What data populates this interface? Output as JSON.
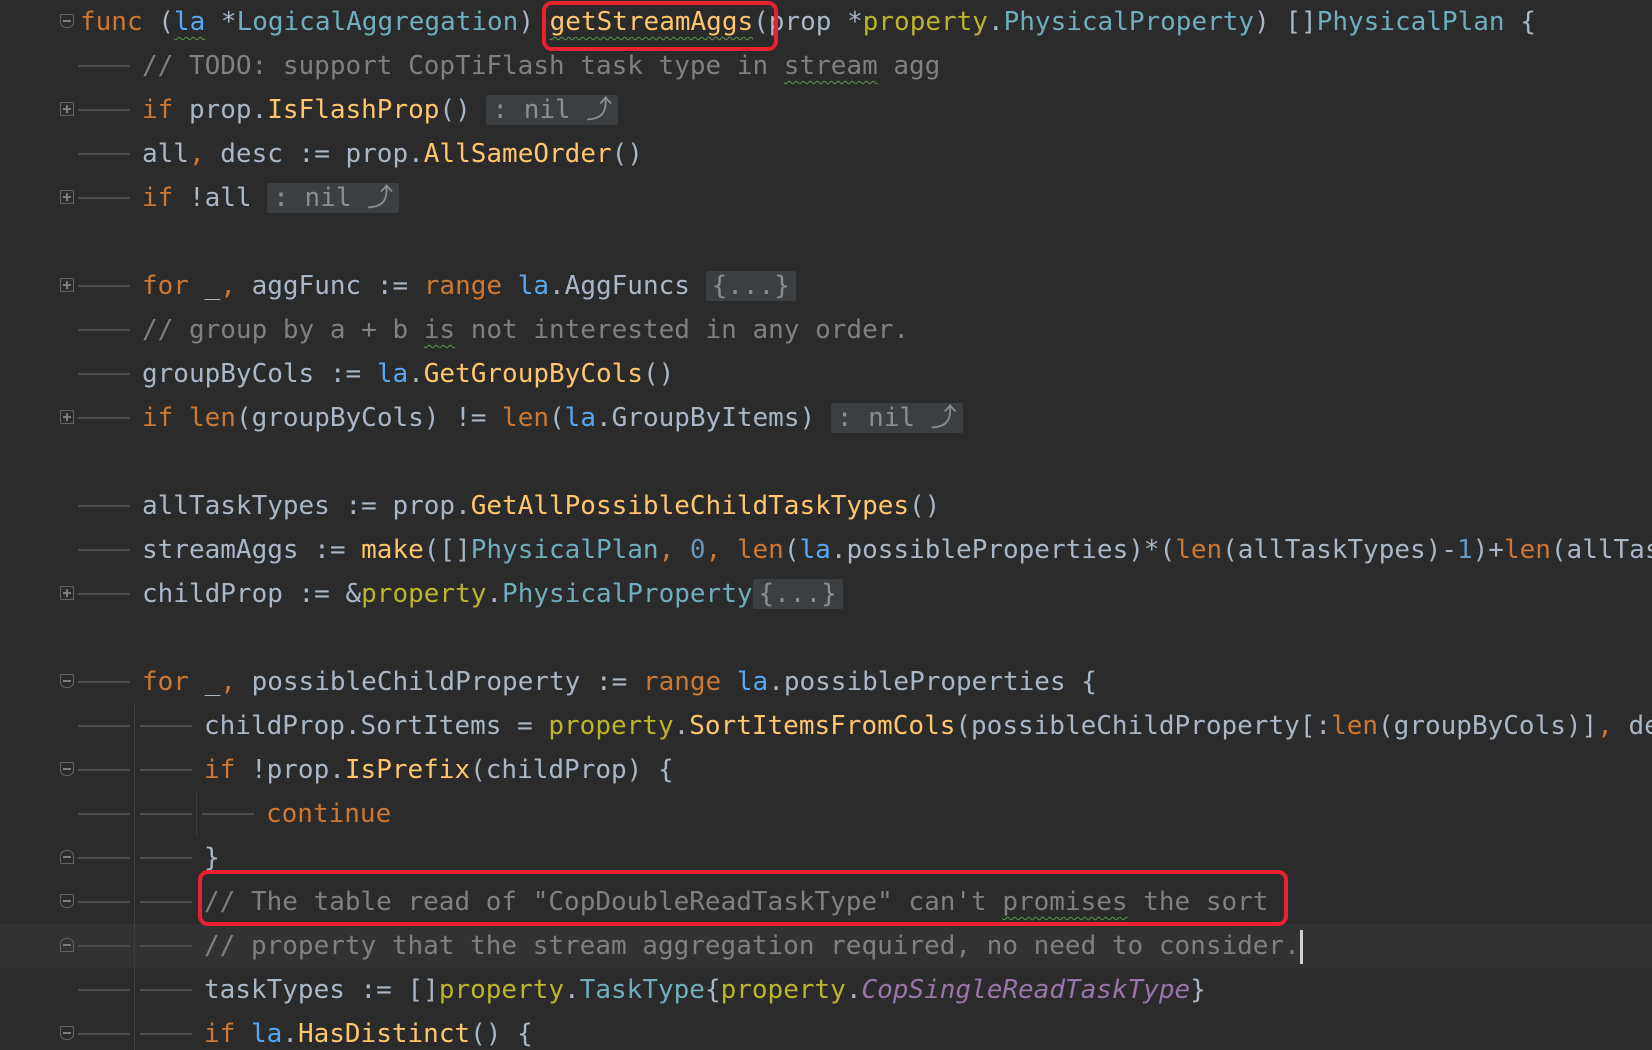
{
  "editor": {
    "language": "go",
    "annotations": [
      "function-name-box",
      "comment-box"
    ],
    "lines": [
      {
        "fold": "top",
        "tokens": [
          {
            "t": "func",
            "c": "kw"
          },
          {
            "t": " (",
            "c": "plain"
          },
          {
            "t": "la",
            "c": "rcv squiggle"
          },
          {
            "t": " *",
            "c": "plain"
          },
          {
            "t": "LogicalAggregation",
            "c": "ty"
          },
          {
            "t": ") ",
            "c": "plain"
          },
          {
            "t": "getStreamAggs",
            "c": "fn squiggle"
          },
          {
            "t": "(",
            "c": "plain"
          },
          {
            "t": "prop",
            "c": "plain"
          },
          {
            "t": " *",
            "c": "plain"
          },
          {
            "t": "property",
            "c": "pkg"
          },
          {
            "t": ".",
            "c": "plain"
          },
          {
            "t": "PhysicalProperty",
            "c": "ty"
          },
          {
            "t": ") []",
            "c": "plain"
          },
          {
            "t": "PhysicalPlan",
            "c": "ty"
          },
          {
            "t": " {",
            "c": "plain"
          }
        ]
      },
      {
        "indent": 1,
        "tokens": [
          {
            "t": "// TODO: support CopTiFlash task type in ",
            "c": "cm"
          },
          {
            "t": "stream",
            "c": "cm squiggle"
          },
          {
            "t": " agg",
            "c": "cm"
          }
        ]
      },
      {
        "indent": 1,
        "fold": "plus",
        "tokens": [
          {
            "t": "if",
            "c": "kw"
          },
          {
            "t": " prop.",
            "c": "plain"
          },
          {
            "t": "IsFlashProp",
            "c": "fn"
          },
          {
            "t": "() ",
            "c": "plain"
          },
          {
            "t": ": nil ⤴",
            "c": "fold-badge"
          }
        ]
      },
      {
        "indent": 1,
        "tokens": [
          {
            "t": "all",
            "c": "plain"
          },
          {
            "t": ",",
            "c": "kw"
          },
          {
            "t": " desc := prop.",
            "c": "plain"
          },
          {
            "t": "AllSameOrder",
            "c": "fn"
          },
          {
            "t": "()",
            "c": "plain"
          }
        ]
      },
      {
        "indent": 1,
        "fold": "plus",
        "tokens": [
          {
            "t": "if",
            "c": "kw"
          },
          {
            "t": " !all ",
            "c": "plain"
          },
          {
            "t": ": nil ⤴",
            "c": "fold-badge"
          }
        ]
      },
      {
        "blank": true,
        "tokens": []
      },
      {
        "indent": 1,
        "fold": "plus",
        "tokens": [
          {
            "t": "for",
            "c": "kw"
          },
          {
            "t": " _",
            "c": "plain"
          },
          {
            "t": ",",
            "c": "kw"
          },
          {
            "t": " aggFunc := ",
            "c": "plain"
          },
          {
            "t": "range",
            "c": "kw"
          },
          {
            "t": " ",
            "c": "plain"
          },
          {
            "t": "la",
            "c": "rcv"
          },
          {
            "t": ".AggFuncs ",
            "c": "plain"
          },
          {
            "t": "{...}",
            "c": "fold-badge"
          }
        ]
      },
      {
        "indent": 1,
        "tokens": [
          {
            "t": "// group by a + b ",
            "c": "cm"
          },
          {
            "t": "is",
            "c": "cm squiggle"
          },
          {
            "t": " not interested in any order.",
            "c": "cm"
          }
        ]
      },
      {
        "indent": 1,
        "tokens": [
          {
            "t": "groupByCols := ",
            "c": "plain"
          },
          {
            "t": "la",
            "c": "rcv"
          },
          {
            "t": ".",
            "c": "plain"
          },
          {
            "t": "GetGroupByCols",
            "c": "fn"
          },
          {
            "t": "()",
            "c": "plain"
          }
        ]
      },
      {
        "indent": 1,
        "fold": "plus",
        "tokens": [
          {
            "t": "if",
            "c": "kw"
          },
          {
            "t": " ",
            "c": "plain"
          },
          {
            "t": "len",
            "c": "kw"
          },
          {
            "t": "(groupByCols) != ",
            "c": "plain"
          },
          {
            "t": "len",
            "c": "kw"
          },
          {
            "t": "(",
            "c": "plain"
          },
          {
            "t": "la",
            "c": "rcv"
          },
          {
            "t": ".GroupByItems) ",
            "c": "plain"
          },
          {
            "t": ": nil ⤴",
            "c": "fold-badge"
          }
        ]
      },
      {
        "blank": true,
        "tokens": []
      },
      {
        "indent": 1,
        "tokens": [
          {
            "t": "allTaskTypes := prop.",
            "c": "plain"
          },
          {
            "t": "GetAllPossibleChildTaskTypes",
            "c": "fn"
          },
          {
            "t": "()",
            "c": "plain"
          }
        ]
      },
      {
        "indent": 1,
        "tokens": [
          {
            "t": "streamAggs := ",
            "c": "plain"
          },
          {
            "t": "make",
            "c": "fn"
          },
          {
            "t": "([]",
            "c": "plain"
          },
          {
            "t": "PhysicalPlan",
            "c": "ty"
          },
          {
            "t": ", ",
            "c": "kw"
          },
          {
            "t": "0",
            "c": "num"
          },
          {
            "t": ", ",
            "c": "kw"
          },
          {
            "t": "len",
            "c": "kw"
          },
          {
            "t": "(",
            "c": "plain"
          },
          {
            "t": "la",
            "c": "rcv"
          },
          {
            "t": ".possibleProperties)*(",
            "c": "plain"
          },
          {
            "t": "len",
            "c": "kw"
          },
          {
            "t": "(allTaskTypes)-",
            "c": "plain"
          },
          {
            "t": "1",
            "c": "num"
          },
          {
            "t": ")+",
            "c": "plain"
          },
          {
            "t": "len",
            "c": "kw"
          },
          {
            "t": "(allTas",
            "c": "plain"
          }
        ]
      },
      {
        "indent": 1,
        "fold": "plus",
        "tokens": [
          {
            "t": "childProp := &",
            "c": "plain"
          },
          {
            "t": "property",
            "c": "pkg"
          },
          {
            "t": ".",
            "c": "plain"
          },
          {
            "t": "PhysicalProperty",
            "c": "ty"
          },
          {
            "t": "{...}",
            "c": "fold-badge"
          }
        ]
      },
      {
        "blank": true,
        "tokens": []
      },
      {
        "indent": 1,
        "fold": "top",
        "tokens": [
          {
            "t": "for",
            "c": "kw"
          },
          {
            "t": " _",
            "c": "plain"
          },
          {
            "t": ",",
            "c": "kw"
          },
          {
            "t": " possibleChildProperty := ",
            "c": "plain"
          },
          {
            "t": "range",
            "c": "kw"
          },
          {
            "t": " ",
            "c": "plain"
          },
          {
            "t": "la",
            "c": "rcv"
          },
          {
            "t": ".possibleProperties {",
            "c": "plain"
          }
        ]
      },
      {
        "indent": 2,
        "tokens": [
          {
            "t": "childProp.SortItems = ",
            "c": "plain"
          },
          {
            "t": "property",
            "c": "pkg"
          },
          {
            "t": ".",
            "c": "plain"
          },
          {
            "t": "SortItemsFromCols",
            "c": "fn"
          },
          {
            "t": "(possibleChildProperty[:",
            "c": "plain"
          },
          {
            "t": "len",
            "c": "kw"
          },
          {
            "t": "(groupByCols)]",
            "c": "plain"
          },
          {
            "t": ", ",
            "c": "kw"
          },
          {
            "t": "de",
            "c": "plain"
          }
        ]
      },
      {
        "indent": 2,
        "fold": "top",
        "tokens": [
          {
            "t": "if",
            "c": "kw"
          },
          {
            "t": " !prop.",
            "c": "plain"
          },
          {
            "t": "IsPrefix",
            "c": "fn"
          },
          {
            "t": "(childProp) {",
            "c": "plain"
          }
        ]
      },
      {
        "indent": 3,
        "tokens": [
          {
            "t": "continue",
            "c": "kw"
          }
        ]
      },
      {
        "indent": 2,
        "fold": "end",
        "tokens": [
          {
            "t": "}",
            "c": "plain"
          }
        ]
      },
      {
        "indent": 2,
        "fold": "top",
        "tokens": [
          {
            "t": "// The table read of ",
            "c": "cm"
          },
          {
            "t": "\"CopDoubleReadTaskType\"",
            "c": "cm"
          },
          {
            "t": " can't ",
            "c": "cm"
          },
          {
            "t": "promises",
            "c": "cm squiggle"
          },
          {
            "t": " the sort",
            "c": "cm"
          }
        ]
      },
      {
        "indent": 2,
        "fold": "end",
        "current": true,
        "caret": true,
        "tokens": [
          {
            "t": "// property that the stream aggregation required, no need to consider.",
            "c": "cm"
          }
        ]
      },
      {
        "indent": 2,
        "tokens": [
          {
            "t": "taskTypes := []",
            "c": "plain"
          },
          {
            "t": "property",
            "c": "pkg"
          },
          {
            "t": ".",
            "c": "plain"
          },
          {
            "t": "TaskType",
            "c": "ty"
          },
          {
            "t": "{",
            "c": "plain"
          },
          {
            "t": "property",
            "c": "pkg"
          },
          {
            "t": ".",
            "c": "plain"
          },
          {
            "t": "CopSingleReadTaskType",
            "c": "it"
          },
          {
            "t": "}",
            "c": "plain"
          }
        ]
      },
      {
        "indent": 2,
        "fold": "top",
        "tokens": [
          {
            "t": "if",
            "c": "kw"
          },
          {
            "t": " ",
            "c": "plain"
          },
          {
            "t": "la",
            "c": "rcv"
          },
          {
            "t": ".",
            "c": "plain"
          },
          {
            "t": "HasDistinct",
            "c": "fn"
          },
          {
            "t": "() {",
            "c": "plain"
          }
        ]
      }
    ]
  }
}
